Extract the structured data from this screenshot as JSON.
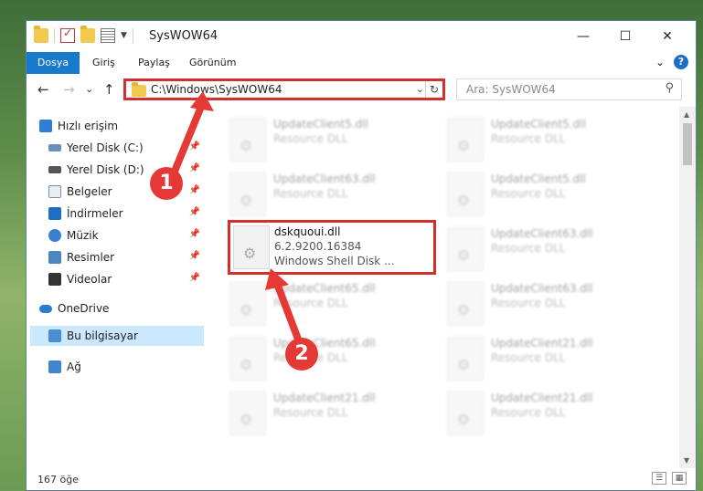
{
  "window": {
    "title": "SysWOW64",
    "controls": {
      "minimize": "—",
      "maximize": "☐",
      "close": "✕"
    }
  },
  "ribbon": {
    "tabs": [
      "Dosya",
      "Giriş",
      "Paylaş",
      "Görünüm"
    ],
    "collapse": "⌄",
    "help": "?"
  },
  "navigation": {
    "back": "←",
    "forward": "→",
    "recent": "⌄",
    "up": "↑",
    "address": "C:\\Windows\\SysWOW64",
    "address_dropdown": "⌄",
    "refresh": "↻",
    "search_placeholder": "Ara: SysWOW64",
    "search_icon": "⚲"
  },
  "sidebar": {
    "items": [
      {
        "label": "Hızlı erişim",
        "icon": "star-icon",
        "pinned": false
      },
      {
        "label": "Yerel Disk (C:)",
        "icon": "drive-icon",
        "pinned": true
      },
      {
        "label": "Yerel Disk (D:)",
        "icon": "drive-icon",
        "pinned": true
      },
      {
        "label": "Belgeler",
        "icon": "documents-icon",
        "pinned": true
      },
      {
        "label": "İndirmeler",
        "icon": "download-icon",
        "pinned": true
      },
      {
        "label": "Müzik",
        "icon": "music-icon",
        "pinned": true
      },
      {
        "label": "Resimler",
        "icon": "pictures-icon",
        "pinned": true
      },
      {
        "label": "Videolar",
        "icon": "videos-icon",
        "pinned": true
      },
      {
        "label": "OneDrive",
        "icon": "cloud-icon",
        "pinned": false
      },
      {
        "label": "Bu bilgisayar",
        "icon": "computer-icon",
        "pinned": false,
        "selected": true
      },
      {
        "label": "Ağ",
        "icon": "network-icon",
        "pinned": false
      }
    ],
    "pin_glyph": "📌"
  },
  "files": {
    "highlighted": {
      "name": "dskquoui.dll",
      "version": "6.2.9200.16384",
      "description": "Windows Shell Disk ..."
    },
    "col1": [
      {
        "name": "UpdateClient5.dll",
        "desc": "Resource DLL"
      },
      {
        "name": "UpdateClient63.dll",
        "desc": "Resource DLL"
      },
      {
        "name": "UpdateClient65.dll",
        "desc": "Resource DLL"
      },
      {
        "name": "UpdateClient65.dll",
        "desc": "Resource DLL"
      },
      {
        "name": "UpdateClient21.dll",
        "desc": "Resource DLL"
      }
    ],
    "col2": [
      {
        "name": "UpdateClient5.dll",
        "desc": "Resource DLL"
      },
      {
        "name": "UpdateClient5.dll",
        "desc": "Resource DLL"
      },
      {
        "name": "UpdateClient63.dll",
        "desc": "Resource DLL"
      },
      {
        "name": "UpdateClient63.dll",
        "desc": "Resource DLL"
      },
      {
        "name": "UpdateClient21.dll",
        "desc": "Resource DLL"
      },
      {
        "name": "UpdateClient21.dll",
        "desc": "Resource DLL"
      }
    ]
  },
  "status": {
    "count": "167 öğe",
    "view_details": "☰",
    "view_tiles": "▦"
  },
  "annotations": {
    "badge1": "1",
    "badge2": "2",
    "color": "#e53935"
  }
}
